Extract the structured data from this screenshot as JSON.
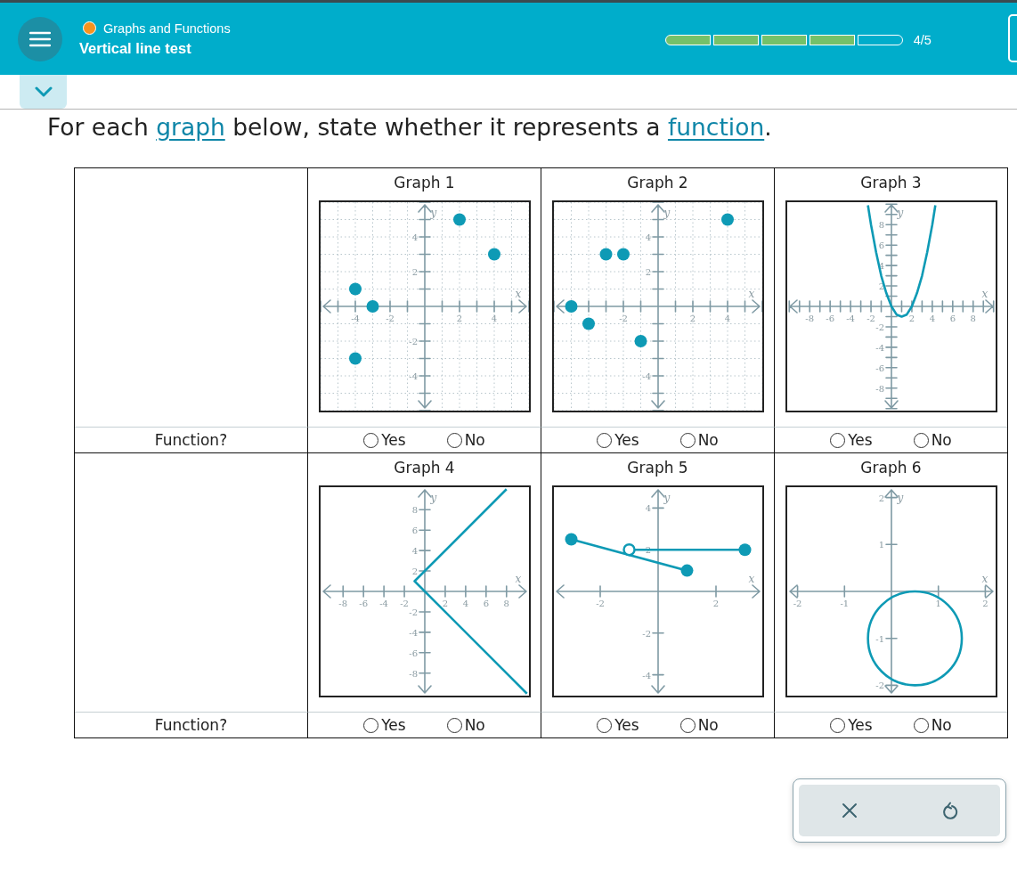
{
  "header": {
    "course": "Graphs and Functions",
    "title": "Vertical line test",
    "progress": [
      {
        "done": true
      },
      {
        "done": true
      },
      {
        "done": true
      },
      {
        "done": true
      },
      {
        "done": false
      }
    ],
    "progress_text": "4/5"
  },
  "question": [
    {
      "kind": "text",
      "text": "For each "
    },
    {
      "kind": "link",
      "text": "graph"
    },
    {
      "kind": "text",
      "text": " below, state whether it represents a "
    },
    {
      "kind": "link",
      "text": "function"
    },
    {
      "kind": "text",
      "text": "."
    }
  ],
  "table": {
    "rows": [
      {
        "label": "Function?",
        "graphs": [
          {
            "title": "Graph 1",
            "minor_ticks": true,
            "options": [
              {
                "label": "Yes",
                "selected": false
              },
              {
                "label": "No",
                "selected": false
              }
            ],
            "chart_data": {
              "type": "scatter",
              "xlabel": "x",
              "ylabel": "y",
              "xlim": [
                -6,
                6
              ],
              "ylim": [
                -6,
                6
              ],
              "xticks": [
                -4,
                -2,
                2,
                4
              ],
              "yticks": [
                -4,
                -2,
                2,
                4
              ],
              "grid": true,
              "series": [
                {
                  "x": [
                    -4,
                    -3,
                    -4,
                    2,
                    4
                  ],
                  "values": [
                    1,
                    0,
                    -3,
                    5,
                    3
                  ]
                }
              ]
            }
          },
          {
            "title": "Graph 2",
            "minor_ticks": true,
            "options": [
              {
                "label": "Yes",
                "selected": false
              },
              {
                "label": "No",
                "selected": false
              }
            ],
            "chart_data": {
              "type": "scatter",
              "xlabel": "x",
              "ylabel": "y",
              "xlim": [
                -6,
                6
              ],
              "ylim": [
                -6,
                6
              ],
              "xticks": [
                -2,
                2,
                4
              ],
              "yticks": [
                -4,
                2,
                4
              ],
              "grid": true,
              "series": [
                {
                  "x": [
                    -5,
                    -4,
                    -3,
                    -2,
                    -1,
                    4
                  ],
                  "values": [
                    0,
                    -1,
                    3,
                    3,
                    -2,
                    5
                  ]
                }
              ]
            }
          },
          {
            "title": "Graph 3",
            "minor_ticks": true,
            "options": [
              {
                "label": "Yes",
                "selected": false
              },
              {
                "label": "No",
                "selected": false
              }
            ],
            "chart_data": {
              "type": "line",
              "xlabel": "x",
              "ylabel": "y",
              "xlim": [
                -10.2,
                10.2
              ],
              "ylim": [
                -10.2,
                10.2
              ],
              "xticks": [
                -8,
                -6,
                -4,
                -2,
                2,
                4,
                6,
                8
              ],
              "yticks": [
                -8,
                -6,
                -4,
                -2,
                2,
                4,
                6,
                8
              ],
              "grid": false,
              "series": [
                {
                  "x": [
                    -2.3,
                    -2,
                    -1.5,
                    -1,
                    -0.5,
                    0,
                    0.5,
                    1,
                    1.5,
                    2,
                    2.5,
                    3,
                    3.5,
                    4,
                    4.3
                  ],
                  "values": [
                    9.9,
                    8,
                    5.3,
                    3,
                    1.3,
                    0,
                    -0.8,
                    -1,
                    -0.8,
                    0,
                    1.3,
                    3,
                    5.3,
                    8,
                    9.9
                  ]
                }
              ]
            }
          }
        ]
      },
      {
        "label": "Function?",
        "graphs": [
          {
            "title": "Graph 4",
            "minor_ticks": false,
            "options": [
              {
                "label": "Yes",
                "selected": false
              },
              {
                "label": "No",
                "selected": false
              }
            ],
            "chart_data": {
              "type": "line",
              "xlabel": "x",
              "ylabel": "y",
              "xlim": [
                -10.2,
                10.2
              ],
              "ylim": [
                -10.2,
                10.2
              ],
              "xticks": [
                -8,
                -6,
                -4,
                -2,
                2,
                4,
                6,
                8
              ],
              "yticks": [
                -8,
                -6,
                -4,
                -2,
                2,
                4,
                6,
                8
              ],
              "grid": false,
              "series": [
                {
                  "x": [
                    8,
                    -1,
                    10
                  ],
                  "values": [
                    10,
                    1,
                    -10
                  ]
                }
              ]
            }
          },
          {
            "title": "Graph 5",
            "minor_ticks": false,
            "options": [
              {
                "label": "Yes",
                "selected": false
              },
              {
                "label": "No",
                "selected": false
              }
            ],
            "chart_data": {
              "type": "line",
              "xlabel": "x",
              "ylabel": "y",
              "xlim": [
                -3.6,
                3.6
              ],
              "ylim": [
                -5,
                5
              ],
              "xticks": [
                -2,
                2
              ],
              "yticks": [
                -4,
                -2,
                2,
                4
              ],
              "grid": false,
              "series": [
                {
                  "x": [
                    -3,
                    1
                  ],
                  "values": [
                    2.5,
                    1
                  ],
                  "marker": [
                    "filled",
                    "filled"
                  ]
                },
                {
                  "x": [
                    -1,
                    3
                  ],
                  "values": [
                    2,
                    2
                  ],
                  "marker": [
                    "open",
                    "filled"
                  ]
                }
              ]
            }
          },
          {
            "title": "Graph 6",
            "kind": "circle",
            "options": [
              {
                "label": "Yes",
                "selected": false
              },
              {
                "label": "No",
                "selected": false
              }
            ],
            "chart_data": {
              "type": "line",
              "xlabel": "x",
              "ylabel": "y",
              "xlim": [
                -2.22,
                2.22
              ],
              "ylim": [
                -2.22,
                2.22
              ],
              "xticks": [
                -2,
                -1,
                1,
                2
              ],
              "yticks": [
                -2,
                -1,
                1,
                2
              ],
              "grid": false
            }
          }
        ]
      }
    ]
  }
}
